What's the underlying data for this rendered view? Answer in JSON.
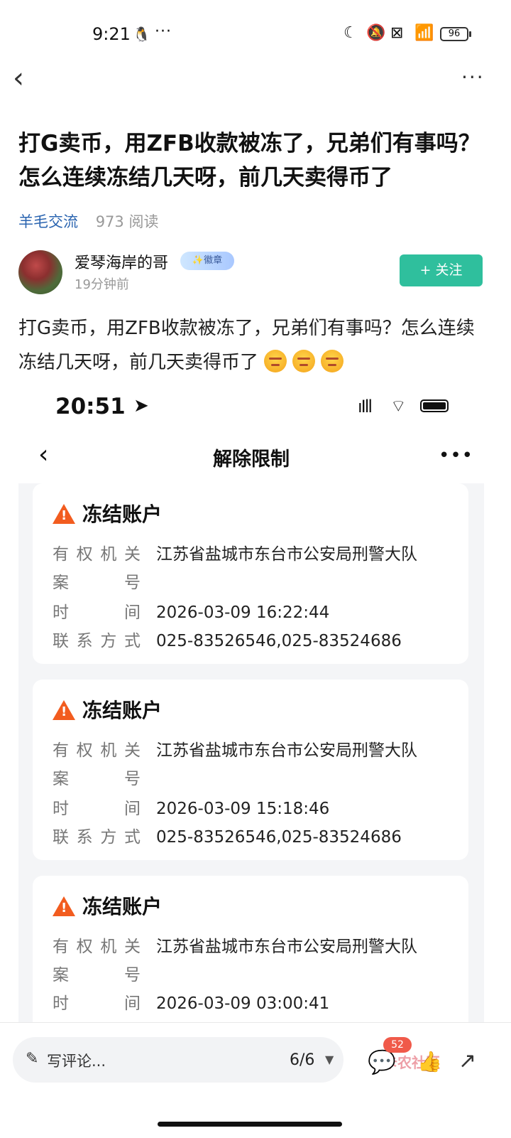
{
  "status_bar": {
    "time": "9:21",
    "qq_icon": "🐧",
    "dots": "···",
    "moon": "☾",
    "bell_off": "🔕",
    "sim_x": "⊠",
    "wifi": "📶",
    "battery": "96"
  },
  "nav": {
    "back": "‹",
    "more": "···"
  },
  "post": {
    "title": "打G卖币，用ZFB收款被冻了，兄弟们有事吗？怎么连续冻结几天呀，前几天卖得币了",
    "category": "羊毛交流",
    "reads": "973 阅读",
    "author": {
      "name": "爱琴海岸的哥",
      "badge": "✨徽章",
      "time": "19分钟前"
    },
    "follow_label": "+ 关注",
    "body": "打G卖币，用ZFB收款被冻了，兄弟们有事吗？怎么连续冻结几天呀，前几天卖得币了"
  },
  "shot": {
    "time": "20:51",
    "arrow": "➤",
    "signal": "ıIll",
    "wifi": "⌔",
    "back": "‹",
    "title": "解除限制",
    "more": "•••",
    "cards": [
      {
        "heading": "冻结账户",
        "authority_key": "有权机关",
        "authority": "江苏省盐城市东台市公安局刑警大队",
        "case_key": "案号",
        "time_key": "时间",
        "time": "2026-03-09 16:22:44",
        "contact_key": "联系方式",
        "contact": "025-83526546,025-83524686"
      },
      {
        "heading": "冻结账户",
        "authority_key": "有权机关",
        "authority": "江苏省盐城市东台市公安局刑警大队",
        "case_key": "案号",
        "time_key": "时间",
        "time": "2026-03-09 15:18:46",
        "contact_key": "联系方式",
        "contact": "025-83526546,025-83524686"
      },
      {
        "heading": "冻结账户",
        "authority_key": "有权机关",
        "authority": "江苏省盐城市东台市公安局刑警大队",
        "case_key": "案号",
        "time_key": "时间",
        "time": "2026-03-09 03:00:41"
      }
    ]
  },
  "bottom_bar": {
    "pen": "✎",
    "comment_placeholder": "写评论...",
    "page_indicator": "6/6",
    "caret": "▼",
    "comment_icon": "💬",
    "comment_count": "52",
    "like_icon": "👍",
    "share_icon": "↗",
    "watermark": "卡农社区"
  }
}
